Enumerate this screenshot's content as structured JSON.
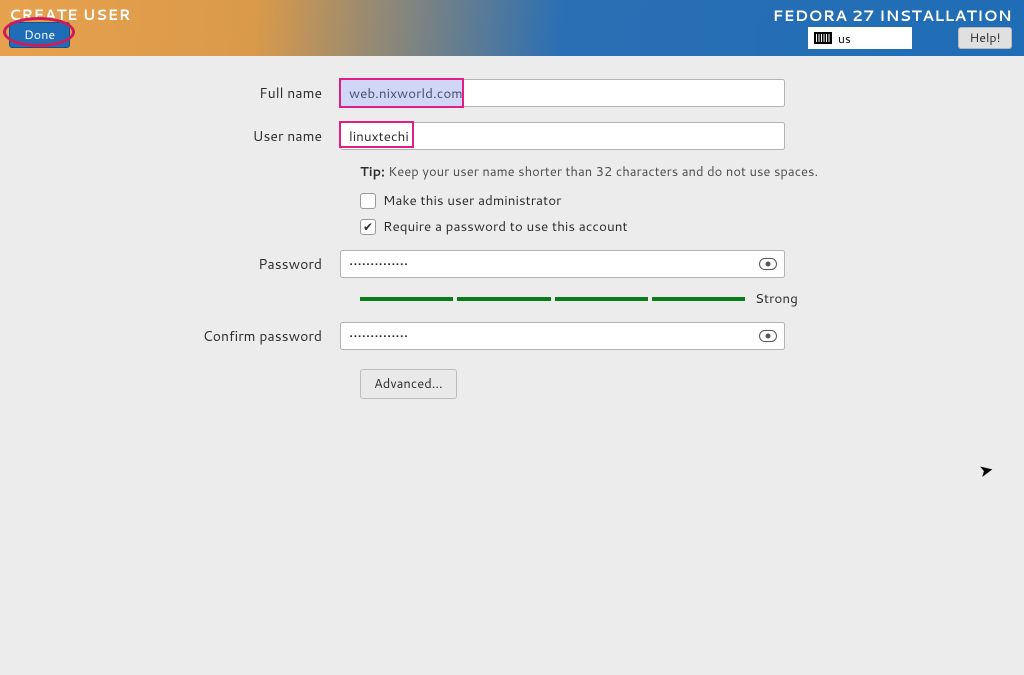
{
  "header": {
    "page_title": "CREATE USER",
    "done_label": "Done",
    "installer_title": "FEDORA 27 INSTALLATION",
    "keyboard_layout": "us",
    "help_label": "Help!"
  },
  "form": {
    "full_name_label": "Full name",
    "full_name_value": "web.nixworld.com",
    "user_name_label": "User name",
    "user_name_value": "linuxtechi",
    "tip_prefix": "Tip:",
    "tip_text": " Keep your user name shorter than 32 characters and do not use spaces.",
    "make_admin_label": "Make this user administrator",
    "make_admin_checked": false,
    "require_pw_label": "Require a password to use this account",
    "require_pw_checked": true,
    "password_label": "Password",
    "password_mask": "••••••••••••••",
    "strength_label": "Strong",
    "confirm_label": "Confirm password",
    "confirm_mask": "••••••••••••••",
    "advanced_label": "Advanced..."
  }
}
